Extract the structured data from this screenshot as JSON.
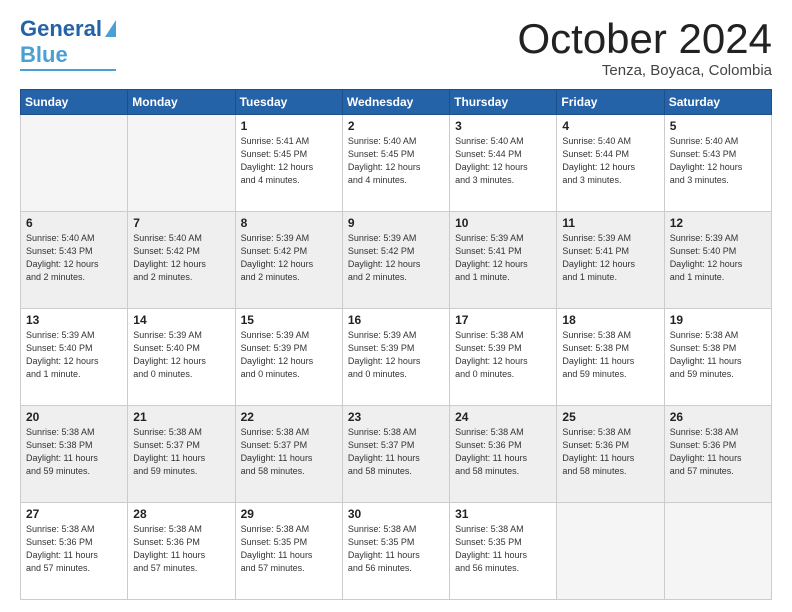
{
  "header": {
    "logo_line1": "General",
    "logo_line2": "Blue",
    "month": "October 2024",
    "location": "Tenza, Boyaca, Colombia"
  },
  "weekdays": [
    "Sunday",
    "Monday",
    "Tuesday",
    "Wednesday",
    "Thursday",
    "Friday",
    "Saturday"
  ],
  "weeks": [
    [
      {
        "day": "",
        "info": ""
      },
      {
        "day": "",
        "info": ""
      },
      {
        "day": "1",
        "info": "Sunrise: 5:41 AM\nSunset: 5:45 PM\nDaylight: 12 hours\nand 4 minutes."
      },
      {
        "day": "2",
        "info": "Sunrise: 5:40 AM\nSunset: 5:45 PM\nDaylight: 12 hours\nand 4 minutes."
      },
      {
        "day": "3",
        "info": "Sunrise: 5:40 AM\nSunset: 5:44 PM\nDaylight: 12 hours\nand 3 minutes."
      },
      {
        "day": "4",
        "info": "Sunrise: 5:40 AM\nSunset: 5:44 PM\nDaylight: 12 hours\nand 3 minutes."
      },
      {
        "day": "5",
        "info": "Sunrise: 5:40 AM\nSunset: 5:43 PM\nDaylight: 12 hours\nand 3 minutes."
      }
    ],
    [
      {
        "day": "6",
        "info": "Sunrise: 5:40 AM\nSunset: 5:43 PM\nDaylight: 12 hours\nand 2 minutes."
      },
      {
        "day": "7",
        "info": "Sunrise: 5:40 AM\nSunset: 5:42 PM\nDaylight: 12 hours\nand 2 minutes."
      },
      {
        "day": "8",
        "info": "Sunrise: 5:39 AM\nSunset: 5:42 PM\nDaylight: 12 hours\nand 2 minutes."
      },
      {
        "day": "9",
        "info": "Sunrise: 5:39 AM\nSunset: 5:42 PM\nDaylight: 12 hours\nand 2 minutes."
      },
      {
        "day": "10",
        "info": "Sunrise: 5:39 AM\nSunset: 5:41 PM\nDaylight: 12 hours\nand 1 minute."
      },
      {
        "day": "11",
        "info": "Sunrise: 5:39 AM\nSunset: 5:41 PM\nDaylight: 12 hours\nand 1 minute."
      },
      {
        "day": "12",
        "info": "Sunrise: 5:39 AM\nSunset: 5:40 PM\nDaylight: 12 hours\nand 1 minute."
      }
    ],
    [
      {
        "day": "13",
        "info": "Sunrise: 5:39 AM\nSunset: 5:40 PM\nDaylight: 12 hours\nand 1 minute."
      },
      {
        "day": "14",
        "info": "Sunrise: 5:39 AM\nSunset: 5:40 PM\nDaylight: 12 hours\nand 0 minutes."
      },
      {
        "day": "15",
        "info": "Sunrise: 5:39 AM\nSunset: 5:39 PM\nDaylight: 12 hours\nand 0 minutes."
      },
      {
        "day": "16",
        "info": "Sunrise: 5:39 AM\nSunset: 5:39 PM\nDaylight: 12 hours\nand 0 minutes."
      },
      {
        "day": "17",
        "info": "Sunrise: 5:38 AM\nSunset: 5:39 PM\nDaylight: 12 hours\nand 0 minutes."
      },
      {
        "day": "18",
        "info": "Sunrise: 5:38 AM\nSunset: 5:38 PM\nDaylight: 11 hours\nand 59 minutes."
      },
      {
        "day": "19",
        "info": "Sunrise: 5:38 AM\nSunset: 5:38 PM\nDaylight: 11 hours\nand 59 minutes."
      }
    ],
    [
      {
        "day": "20",
        "info": "Sunrise: 5:38 AM\nSunset: 5:38 PM\nDaylight: 11 hours\nand 59 minutes."
      },
      {
        "day": "21",
        "info": "Sunrise: 5:38 AM\nSunset: 5:37 PM\nDaylight: 11 hours\nand 59 minutes."
      },
      {
        "day": "22",
        "info": "Sunrise: 5:38 AM\nSunset: 5:37 PM\nDaylight: 11 hours\nand 58 minutes."
      },
      {
        "day": "23",
        "info": "Sunrise: 5:38 AM\nSunset: 5:37 PM\nDaylight: 11 hours\nand 58 minutes."
      },
      {
        "day": "24",
        "info": "Sunrise: 5:38 AM\nSunset: 5:36 PM\nDaylight: 11 hours\nand 58 minutes."
      },
      {
        "day": "25",
        "info": "Sunrise: 5:38 AM\nSunset: 5:36 PM\nDaylight: 11 hours\nand 58 minutes."
      },
      {
        "day": "26",
        "info": "Sunrise: 5:38 AM\nSunset: 5:36 PM\nDaylight: 11 hours\nand 57 minutes."
      }
    ],
    [
      {
        "day": "27",
        "info": "Sunrise: 5:38 AM\nSunset: 5:36 PM\nDaylight: 11 hours\nand 57 minutes."
      },
      {
        "day": "28",
        "info": "Sunrise: 5:38 AM\nSunset: 5:36 PM\nDaylight: 11 hours\nand 57 minutes."
      },
      {
        "day": "29",
        "info": "Sunrise: 5:38 AM\nSunset: 5:35 PM\nDaylight: 11 hours\nand 57 minutes."
      },
      {
        "day": "30",
        "info": "Sunrise: 5:38 AM\nSunset: 5:35 PM\nDaylight: 11 hours\nand 56 minutes."
      },
      {
        "day": "31",
        "info": "Sunrise: 5:38 AM\nSunset: 5:35 PM\nDaylight: 11 hours\nand 56 minutes."
      },
      {
        "day": "",
        "info": ""
      },
      {
        "day": "",
        "info": ""
      }
    ]
  ]
}
